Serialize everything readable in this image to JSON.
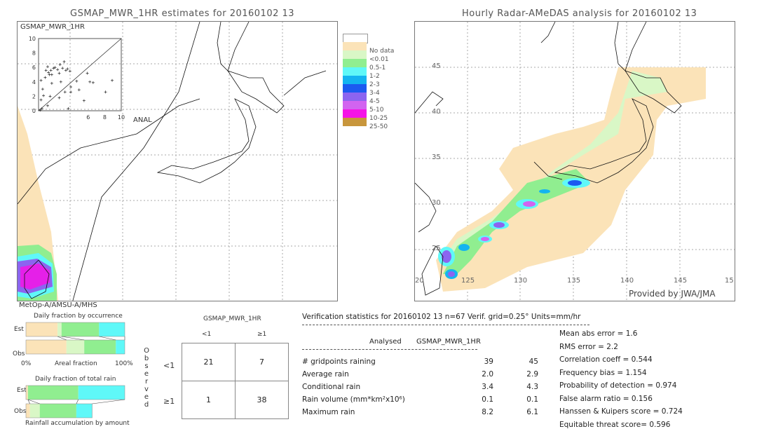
{
  "left_panel": {
    "title": "GSMAP_MWR_1HR estimates for 20160102 13",
    "inset_label": "GSMAP_MWR_1HR",
    "inset_x_label": "ANAL",
    "inset_ticks": [
      "0",
      "2",
      "4",
      "6",
      "8",
      "10"
    ],
    "sensor_label": "MetOp-A/AMSU-A/MHS"
  },
  "right_panel": {
    "title": "Hourly Radar-AMeDAS analysis for 20160102 13",
    "lat_ticks": [
      "45",
      "40",
      "35",
      "30",
      "25"
    ],
    "lon_ticks": [
      "20",
      "125",
      "130",
      "135",
      "140",
      "145",
      "15"
    ],
    "credit": "Provided by JWA/JMA"
  },
  "legend": {
    "items": [
      {
        "label": "",
        "color": "#ffffff"
      },
      {
        "label": "No data",
        "color": "#fbe3b8"
      },
      {
        "label": "<0.01",
        "color": "#d9f7c6"
      },
      {
        "label": "0.5-1",
        "color": "#90ee90"
      },
      {
        "label": "1-2",
        "color": "#5ff8f8"
      },
      {
        "label": "2-3",
        "color": "#14b4f0"
      },
      {
        "label": "3-4",
        "color": "#1c5af0"
      },
      {
        "label": "4-5",
        "color": "#8c64f0"
      },
      {
        "label": "5-10",
        "color": "#d264f0"
      },
      {
        "label": "10-25",
        "color": "#f514e6"
      },
      {
        "label": "25-50",
        "color": "#c8963c"
      }
    ]
  },
  "fraction_charts": {
    "occurrence_title": "Daily fraction by occurrence",
    "rain_title": "Daily fraction of total rain",
    "accum_title": "Rainfall accumulation by amount",
    "est_label": "Est",
    "obs_label": "Obs",
    "axis_left": "0%",
    "axis_mid": "Areal fraction",
    "axis_right": "100%"
  },
  "contingency": {
    "header": "GSMAP_MWR_1HR",
    "col_labels": [
      "<1",
      "≥1"
    ],
    "row_labels": [
      "<1",
      "≥1"
    ],
    "side_label": [
      "O",
      "b",
      "s",
      "e",
      "r",
      "v",
      "e",
      "d"
    ],
    "cells": [
      [
        "21",
        "7"
      ],
      [
        "1",
        "38"
      ]
    ]
  },
  "verification": {
    "header": "Verification statistics for 20160102 13   n=67   Verif. grid=0.25°   Units=mm/hr",
    "col_analysed": "Analysed",
    "col_est": "GSMAP_MWR_1HR",
    "rows": [
      {
        "label": "# gridpoints raining",
        "analysed": "39",
        "est": "45"
      },
      {
        "label": "Average rain",
        "analysed": "2.0",
        "est": "2.9"
      },
      {
        "label": "Conditional rain",
        "analysed": "3.4",
        "est": "4.3"
      },
      {
        "label": "Rain volume (mm*km²x10⁶)",
        "analysed": "0.1",
        "est": "0.1"
      },
      {
        "label": "Maximum rain",
        "analysed": "8.2",
        "est": "6.1"
      }
    ],
    "scores": [
      "Mean abs error = 1.6",
      "RMS error = 2.2",
      "Correlation coeff = 0.544",
      "Frequency bias = 1.154",
      "Probability of detection = 0.974",
      "False alarm ratio = 0.156",
      "Hanssen & Kuipers score = 0.724",
      "Equitable threat score= 0.596"
    ]
  },
  "chart_data": [
    {
      "type": "bar",
      "title": "Daily fraction by occurrence",
      "xlabel": "Areal fraction",
      "categories": [
        "Est",
        "Obs"
      ],
      "series": [
        {
          "name": "No data",
          "color": "#fbe3b8",
          "values": [
            0.32,
            0.41
          ]
        },
        {
          "name": "<0.01",
          "color": "#d9f7c6",
          "values": [
            0.04,
            0.18
          ]
        },
        {
          "name": "0.5-1",
          "color": "#90ee90",
          "values": [
            0.38,
            0.32
          ]
        },
        {
          "name": "1-2",
          "color": "#5ff8f8",
          "values": [
            0.26,
            0.09
          ]
        }
      ],
      "xlim": [
        0,
        1
      ]
    },
    {
      "type": "bar",
      "title": "Daily fraction of total rain",
      "xlabel": "Rainfall accumulation by amount",
      "categories": [
        "Est",
        "Obs"
      ],
      "series": [
        {
          "name": "No data",
          "color": "#fbe3b8",
          "values": [
            0.02,
            0.04
          ]
        },
        {
          "name": "<0.01",
          "color": "#d9f7c6",
          "values": [
            0.0,
            0.1
          ]
        },
        {
          "name": "0.5-1",
          "color": "#90ee90",
          "values": [
            0.51,
            0.37
          ]
        },
        {
          "name": "1-2",
          "color": "#5ff8f8",
          "values": [
            0.47,
            0.16
          ]
        }
      ],
      "xlim": [
        0,
        1
      ]
    },
    {
      "type": "scatter",
      "title": "GSMAP_MWR_1HR",
      "xlabel": "ANAL",
      "ylabel": "GSMAP_MWR_1HR",
      "xlim": [
        0,
        10
      ],
      "ylim": [
        0,
        10
      ],
      "points": [
        [
          0.3,
          4.2
        ],
        [
          0.5,
          3.0
        ],
        [
          0.6,
          2.1
        ],
        [
          0.3,
          1.5
        ],
        [
          0.8,
          4.6
        ],
        [
          0.9,
          5.6
        ],
        [
          1.1,
          6.1
        ],
        [
          1.2,
          5.3
        ],
        [
          1.3,
          5.0
        ],
        [
          1.5,
          5.6
        ],
        [
          1.6,
          5.0
        ],
        [
          1.8,
          5.9
        ],
        [
          2.0,
          6.0
        ],
        [
          2.3,
          5.7
        ],
        [
          2.5,
          5.2
        ],
        [
          2.6,
          6.4
        ],
        [
          2.9,
          5.9
        ],
        [
          3.1,
          6.8
        ],
        [
          3.3,
          5.6
        ],
        [
          3.5,
          5.8
        ],
        [
          3.8,
          5.5
        ],
        [
          2.7,
          4.0
        ],
        [
          1.6,
          3.8
        ],
        [
          1.4,
          2.0
        ],
        [
          3.2,
          2.6
        ],
        [
          2.5,
          1.8
        ],
        [
          3.9,
          3.3
        ],
        [
          3.9,
          2.6
        ],
        [
          4.6,
          4.1
        ],
        [
          4.9,
          2.9
        ],
        [
          5.9,
          5.2
        ],
        [
          6.2,
          4.0
        ],
        [
          6.6,
          3.9
        ],
        [
          8.1,
          2.6
        ],
        [
          8.9,
          4.2
        ],
        [
          5.5,
          1.4
        ],
        [
          1.1,
          0.7
        ],
        [
          0.4,
          0.3
        ],
        [
          0.2,
          0.1
        ],
        [
          3.6,
          0.3
        ]
      ]
    }
  ]
}
